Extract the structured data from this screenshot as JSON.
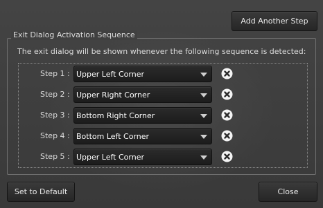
{
  "buttons": {
    "add_step": "Add Another Step",
    "set_default": "Set to Default",
    "close": "Close"
  },
  "group": {
    "title": "Exit Dialog Activation Sequence",
    "description": "The exit dialog will be shown whenever the following sequence is detected:"
  },
  "steps": [
    {
      "label": "Step 1 :",
      "value": "Upper Left Corner"
    },
    {
      "label": "Step 2 :",
      "value": "Upper Right Corner"
    },
    {
      "label": "Step 3 :",
      "value": "Bottom Right Corner"
    },
    {
      "label": "Step 4 :",
      "value": "Bottom Left Corner"
    },
    {
      "label": "Step 5 :",
      "value": "Upper Left Corner"
    }
  ],
  "icons": {
    "dropdown": "chevron-down-icon",
    "remove": "close-circle-icon"
  }
}
